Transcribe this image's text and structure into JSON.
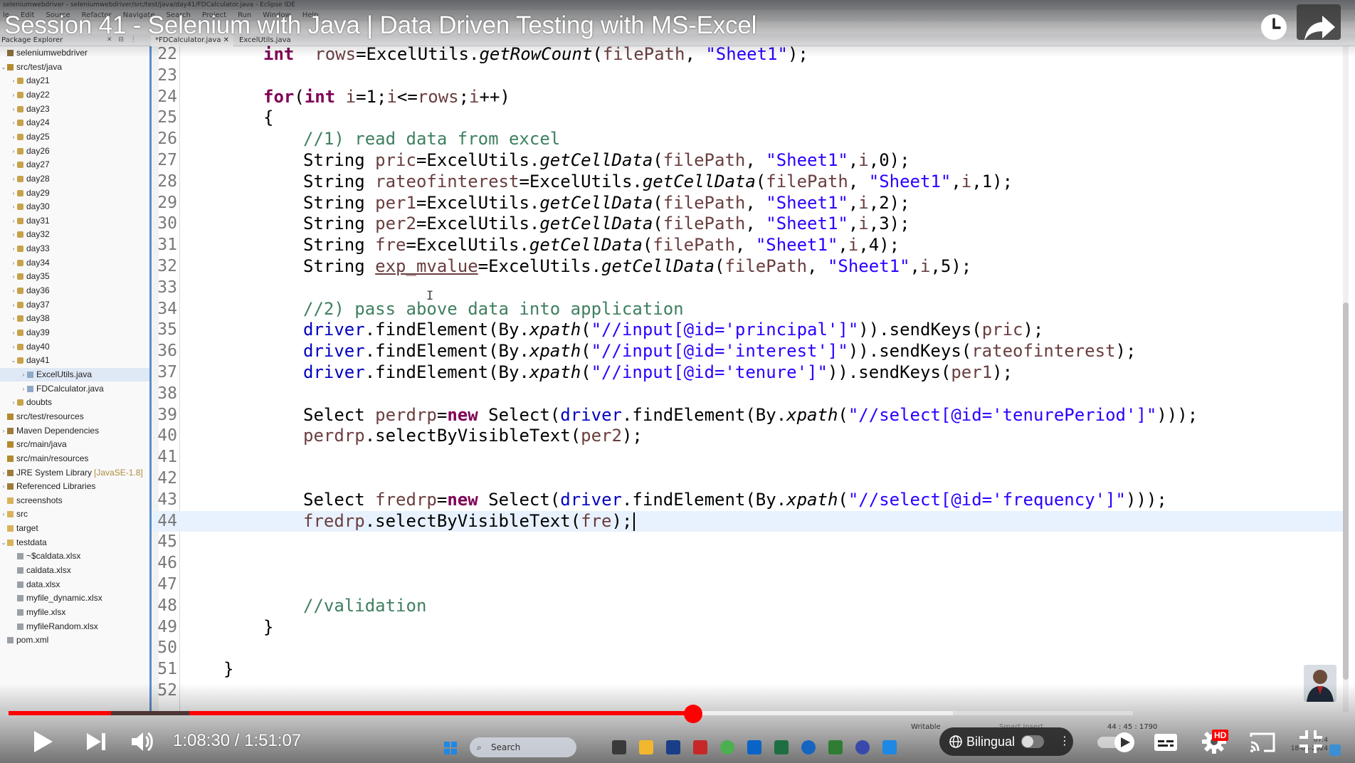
{
  "eclipse": {
    "window_title": "seleniumwebdriver - seleniumwebdriver/src/test/java/day41/FDCalculator.java - Eclipse IDE",
    "menu": [
      "le",
      "Edit",
      "Source",
      "Refactor",
      "Navigate",
      "Search",
      "Project",
      "Run",
      "Window",
      "Help"
    ],
    "package_explorer_title": "Package Explorer",
    "package_explorer_controls": "✕ ⊟ ⋮",
    "editor_tabs": [
      {
        "label": "*FDCalculator.java ✕",
        "active": true
      },
      {
        "label": "ExcelUtils.java",
        "active": false
      }
    ],
    "status": {
      "writable": "Writable",
      "insert_mode": "Smart Insert",
      "position": "44 : 45 : 1790"
    }
  },
  "video": {
    "title": "Session 41 - Selenium with Java | Data Driven Testing with MS-Excel",
    "time": "1:08:30 / 1:51:07",
    "progress_played": 0.609,
    "progress_buffered": 0.84,
    "bilingual_label": "Bilingual",
    "hd_label": "HD"
  },
  "taskbar": {
    "search_placeholder": "Search",
    "clock_time": "07:4",
    "clock_date": "18-04-2024"
  },
  "tree": [
    {
      "label": "seleniumwebdriver",
      "depth": 0,
      "twisty": "",
      "icon": "project"
    },
    {
      "label": "src/test/java",
      "depth": 0,
      "twisty": "⌄",
      "icon": "source-folder"
    },
    {
      "label": "day21",
      "depth": 1,
      "twisty": "›",
      "icon": "package"
    },
    {
      "label": "day22",
      "depth": 1,
      "twisty": "›",
      "icon": "package"
    },
    {
      "label": "day23",
      "depth": 1,
      "twisty": "›",
      "icon": "package"
    },
    {
      "label": "day24",
      "depth": 1,
      "twisty": "›",
      "icon": "package"
    },
    {
      "label": "day25",
      "depth": 1,
      "twisty": "›",
      "icon": "package"
    },
    {
      "label": "day26",
      "depth": 1,
      "twisty": "›",
      "icon": "package"
    },
    {
      "label": "day27",
      "depth": 1,
      "twisty": "›",
      "icon": "package"
    },
    {
      "label": "day28",
      "depth": 1,
      "twisty": "›",
      "icon": "package"
    },
    {
      "label": "day29",
      "depth": 1,
      "twisty": "›",
      "icon": "package"
    },
    {
      "label": "day30",
      "depth": 1,
      "twisty": "›",
      "icon": "package"
    },
    {
      "label": "day31",
      "depth": 1,
      "twisty": "›",
      "icon": "package"
    },
    {
      "label": "day32",
      "depth": 1,
      "twisty": "›",
      "icon": "package"
    },
    {
      "label": "day33",
      "depth": 1,
      "twisty": "›",
      "icon": "package"
    },
    {
      "label": "day34",
      "depth": 1,
      "twisty": "›",
      "icon": "package"
    },
    {
      "label": "day35",
      "depth": 1,
      "twisty": "›",
      "icon": "package"
    },
    {
      "label": "day36",
      "depth": 1,
      "twisty": "›",
      "icon": "package"
    },
    {
      "label": "day37",
      "depth": 1,
      "twisty": "›",
      "icon": "package"
    },
    {
      "label": "day38",
      "depth": 1,
      "twisty": "›",
      "icon": "package"
    },
    {
      "label": "day39",
      "depth": 1,
      "twisty": "›",
      "icon": "package"
    },
    {
      "label": "day40",
      "depth": 1,
      "twisty": "›",
      "icon": "package"
    },
    {
      "label": "day41",
      "depth": 1,
      "twisty": "⌄",
      "icon": "package"
    },
    {
      "label": "ExcelUtils.java",
      "depth": 2,
      "twisty": "›",
      "icon": "java-file",
      "selected": true
    },
    {
      "label": "FDCalculator.java",
      "depth": 2,
      "twisty": "›",
      "icon": "java-file"
    },
    {
      "label": "doubts",
      "depth": 1,
      "twisty": "›",
      "icon": "package"
    },
    {
      "label": "src/test/resources",
      "depth": 0,
      "twisty": "",
      "icon": "source-folder"
    },
    {
      "label": "Maven Dependencies",
      "depth": 0,
      "twisty": "›",
      "icon": "library"
    },
    {
      "label": "src/main/java",
      "depth": 0,
      "twisty": "",
      "icon": "source-folder"
    },
    {
      "label": "src/main/resources",
      "depth": 0,
      "twisty": "",
      "icon": "source-folder"
    },
    {
      "label": "JRE System Library",
      "extra": "[JavaSE-1.8]",
      "depth": 0,
      "twisty": "›",
      "icon": "library"
    },
    {
      "label": "Referenced Libraries",
      "depth": 0,
      "twisty": "›",
      "icon": "library"
    },
    {
      "label": "screenshots",
      "depth": 0,
      "twisty": "",
      "icon": "folder"
    },
    {
      "label": "src",
      "depth": 0,
      "twisty": "›",
      "icon": "folder"
    },
    {
      "label": "target",
      "depth": 0,
      "twisty": "",
      "icon": "folder"
    },
    {
      "label": "testdata",
      "depth": 0,
      "twisty": "⌄",
      "icon": "folder"
    },
    {
      "label": "~$caldata.xlsx",
      "depth": 1,
      "twisty": "",
      "icon": "file"
    },
    {
      "label": "caldata.xlsx",
      "depth": 1,
      "twisty": "",
      "icon": "file"
    },
    {
      "label": "data.xlsx",
      "depth": 1,
      "twisty": "",
      "icon": "file"
    },
    {
      "label": "myfile_dynamic.xlsx",
      "depth": 1,
      "twisty": "",
      "icon": "file"
    },
    {
      "label": "myfile.xlsx",
      "depth": 1,
      "twisty": "",
      "icon": "file"
    },
    {
      "label": "myfileRandom.xlsx",
      "depth": 1,
      "twisty": "",
      "icon": "file"
    },
    {
      "label": "pom.xml",
      "depth": 0,
      "twisty": "",
      "icon": "file"
    }
  ],
  "code": {
    "current_line": 44,
    "lines": [
      {
        "n": "22",
        "indent": 2,
        "tokens": [
          [
            "kw",
            "int"
          ],
          [
            "",
            "  "
          ],
          [
            "var",
            "rows"
          ],
          [
            "",
            "=ExcelUtils."
          ],
          [
            "ita",
            "getRowCount"
          ],
          [
            "",
            "("
          ],
          [
            "var",
            "filePath"
          ],
          [
            "",
            ", "
          ],
          [
            "str",
            "\"Sheet1\""
          ],
          [
            "",
            ");"
          ]
        ]
      },
      {
        "n": "23",
        "indent": 0,
        "tokens": []
      },
      {
        "n": "24",
        "indent": 2,
        "tokens": [
          [
            "kw",
            "for"
          ],
          [
            "",
            "("
          ],
          [
            "kw",
            "int"
          ],
          [
            "",
            " "
          ],
          [
            "var",
            "i"
          ],
          [
            "",
            "=1;"
          ],
          [
            "var",
            "i"
          ],
          [
            "",
            "<="
          ],
          [
            "var",
            "rows"
          ],
          [
            "",
            ";"
          ],
          [
            "var",
            "i"
          ],
          [
            "",
            "++)"
          ]
        ]
      },
      {
        "n": "25",
        "indent": 2,
        "tokens": [
          [
            "",
            "{"
          ]
        ]
      },
      {
        "n": "26",
        "indent": 3,
        "tokens": [
          [
            "cmt",
            "//1) read data from excel"
          ]
        ]
      },
      {
        "n": "27",
        "indent": 3,
        "tokens": [
          [
            "",
            "String "
          ],
          [
            "var",
            "pric"
          ],
          [
            "",
            "=ExcelUtils."
          ],
          [
            "ita",
            "getCellData"
          ],
          [
            "",
            "("
          ],
          [
            "var",
            "filePath"
          ],
          [
            "",
            ", "
          ],
          [
            "str",
            "\"Sheet1\""
          ],
          [
            "",
            ","
          ],
          [
            "var",
            "i"
          ],
          [
            "",
            ",0);"
          ]
        ]
      },
      {
        "n": "28",
        "indent": 3,
        "tokens": [
          [
            "",
            "String "
          ],
          [
            "var",
            "rateofinterest"
          ],
          [
            "",
            "=ExcelUtils."
          ],
          [
            "ita",
            "getCellData"
          ],
          [
            "",
            "("
          ],
          [
            "var",
            "filePath"
          ],
          [
            "",
            ", "
          ],
          [
            "str",
            "\"Sheet1\""
          ],
          [
            "",
            ","
          ],
          [
            "var",
            "i"
          ],
          [
            "",
            ",1);"
          ]
        ]
      },
      {
        "n": "29",
        "indent": 3,
        "tokens": [
          [
            "",
            "String "
          ],
          [
            "var",
            "per1"
          ],
          [
            "",
            "=ExcelUtils."
          ],
          [
            "ita",
            "getCellData"
          ],
          [
            "",
            "("
          ],
          [
            "var",
            "filePath"
          ],
          [
            "",
            ", "
          ],
          [
            "str",
            "\"Sheet1\""
          ],
          [
            "",
            ","
          ],
          [
            "var",
            "i"
          ],
          [
            "",
            ",2);"
          ]
        ]
      },
      {
        "n": "30",
        "indent": 3,
        "tokens": [
          [
            "",
            "String "
          ],
          [
            "var",
            "per2"
          ],
          [
            "",
            "=ExcelUtils."
          ],
          [
            "ita",
            "getCellData"
          ],
          [
            "",
            "("
          ],
          [
            "var",
            "filePath"
          ],
          [
            "",
            ", "
          ],
          [
            "str",
            "\"Sheet1\""
          ],
          [
            "",
            ","
          ],
          [
            "var",
            "i"
          ],
          [
            "",
            ",3);"
          ]
        ]
      },
      {
        "n": "31",
        "indent": 3,
        "tokens": [
          [
            "",
            "String "
          ],
          [
            "var",
            "fre"
          ],
          [
            "",
            "=ExcelUtils."
          ],
          [
            "ita",
            "getCellData"
          ],
          [
            "",
            "("
          ],
          [
            "var",
            "filePath"
          ],
          [
            "",
            ", "
          ],
          [
            "str",
            "\"Sheet1\""
          ],
          [
            "",
            ","
          ],
          [
            "var",
            "i"
          ],
          [
            "",
            ",4);"
          ]
        ]
      },
      {
        "n": "32",
        "indent": 3,
        "tokens": [
          [
            "",
            "String "
          ],
          [
            "var unl",
            "exp_mvalue"
          ],
          [
            "",
            "=ExcelUtils."
          ],
          [
            "ita",
            "getCellData"
          ],
          [
            "",
            "("
          ],
          [
            "var",
            "filePath"
          ],
          [
            "",
            ", "
          ],
          [
            "str",
            "\"Sheet1\""
          ],
          [
            "",
            ","
          ],
          [
            "var",
            "i"
          ],
          [
            "",
            ",5);"
          ]
        ]
      },
      {
        "n": "33",
        "indent": 0,
        "tokens": []
      },
      {
        "n": "34",
        "indent": 3,
        "tokens": [
          [
            "cmt",
            "//2) pass above data into application"
          ]
        ]
      },
      {
        "n": "35",
        "indent": 3,
        "tokens": [
          [
            "fld",
            "driver"
          ],
          [
            "",
            ".findElement(By."
          ],
          [
            "ita",
            "xpath"
          ],
          [
            "",
            "("
          ],
          [
            "str",
            "\"//input[@id='principal']\""
          ],
          [
            "",
            "))."
          ],
          [
            "",
            "sendKeys("
          ],
          [
            "var",
            "pric"
          ],
          [
            "",
            ");"
          ]
        ]
      },
      {
        "n": "36",
        "indent": 3,
        "tokens": [
          [
            "fld",
            "driver"
          ],
          [
            "",
            ".findElement(By."
          ],
          [
            "ita",
            "xpath"
          ],
          [
            "",
            "("
          ],
          [
            "str",
            "\"//input[@id='interest']\""
          ],
          [
            "",
            "))."
          ],
          [
            "",
            "sendKeys("
          ],
          [
            "var",
            "rateofinterest"
          ],
          [
            "",
            ");"
          ]
        ]
      },
      {
        "n": "37",
        "indent": 3,
        "tokens": [
          [
            "fld",
            "driver"
          ],
          [
            "",
            ".findElement(By."
          ],
          [
            "ita",
            "xpath"
          ],
          [
            "",
            "("
          ],
          [
            "str",
            "\"//input[@id='tenure']\""
          ],
          [
            "",
            "))."
          ],
          [
            "",
            "sendKeys("
          ],
          [
            "var",
            "per1"
          ],
          [
            "",
            ");"
          ]
        ]
      },
      {
        "n": "38",
        "indent": 0,
        "tokens": []
      },
      {
        "n": "39",
        "indent": 3,
        "tokens": [
          [
            "",
            "Select "
          ],
          [
            "var",
            "perdrp"
          ],
          [
            "",
            "="
          ],
          [
            "kw",
            "new"
          ],
          [
            "",
            " Select("
          ],
          [
            "fld",
            "driver"
          ],
          [
            "",
            ".findElement(By."
          ],
          [
            "ita",
            "xpath"
          ],
          [
            "",
            "("
          ],
          [
            "str",
            "\"//select[@id='tenurePeriod']\""
          ],
          [
            "",
            ")));"
          ]
        ]
      },
      {
        "n": "40",
        "indent": 3,
        "tokens": [
          [
            "var",
            "perdrp"
          ],
          [
            "",
            ".selectByVisibleText("
          ],
          [
            "var",
            "per2"
          ],
          [
            "",
            ");"
          ]
        ]
      },
      {
        "n": "41",
        "indent": 0,
        "tokens": []
      },
      {
        "n": "42",
        "indent": 0,
        "tokens": []
      },
      {
        "n": "43",
        "indent": 3,
        "tokens": [
          [
            "",
            "Select "
          ],
          [
            "var",
            "fredrp"
          ],
          [
            "",
            "="
          ],
          [
            "kw",
            "new"
          ],
          [
            "",
            " Select("
          ],
          [
            "fld",
            "driver"
          ],
          [
            "",
            ".findElement(By."
          ],
          [
            "ita",
            "xpath"
          ],
          [
            "",
            "("
          ],
          [
            "str",
            "\"//select[@id='frequency']\""
          ],
          [
            "",
            ")));"
          ]
        ]
      },
      {
        "n": "44",
        "indent": 3,
        "tokens": [
          [
            "var",
            "fredrp"
          ],
          [
            "",
            ".selectByVisibleText("
          ],
          [
            "var",
            "fre"
          ],
          [
            "",
            ");"
          ]
        ]
      },
      {
        "n": "45",
        "indent": 0,
        "tokens": []
      },
      {
        "n": "46",
        "indent": 0,
        "tokens": []
      },
      {
        "n": "47",
        "indent": 0,
        "tokens": []
      },
      {
        "n": "48",
        "indent": 3,
        "tokens": [
          [
            "cmt",
            "//validation"
          ]
        ]
      },
      {
        "n": "49",
        "indent": 2,
        "tokens": [
          [
            "",
            "}"
          ]
        ]
      },
      {
        "n": "50",
        "indent": 0,
        "tokens": []
      },
      {
        "n": "51",
        "indent": 1,
        "tokens": [
          [
            "",
            "}"
          ]
        ]
      },
      {
        "n": "52",
        "indent": 0,
        "tokens": []
      }
    ]
  },
  "colors": {
    "keyword": "#7f0055",
    "string": "#2a00ff",
    "comment": "#3f7f5f",
    "field": "#0000c0",
    "local_var": "#6a3e3e",
    "progress": "#ff0000",
    "current_line": "#e8f2fe"
  }
}
